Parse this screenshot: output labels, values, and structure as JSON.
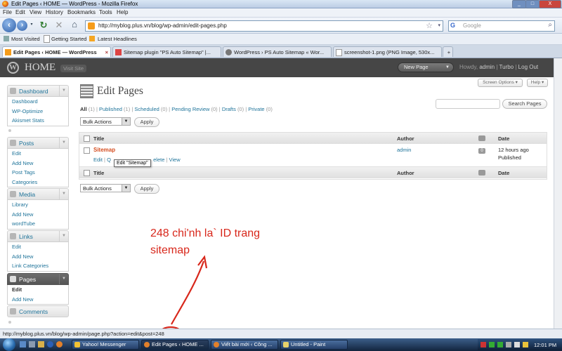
{
  "window": {
    "title": "Edit Pages ‹ HOME — WordPress - Mozilla Firefox",
    "min": "_",
    "max": "□",
    "close": "X"
  },
  "menu": [
    "File",
    "Edit",
    "View",
    "History",
    "Bookmarks",
    "Tools",
    "Help"
  ],
  "nav": {
    "url": "http://myblog.plus.vn/blog/wp-admin/edit-pages.php",
    "search_placeholder": "Google"
  },
  "bookmarks": [
    "Most Visited",
    "Getting Started",
    "Latest Headlines"
  ],
  "tabs": [
    {
      "label": "Edit Pages ‹ HOME — WordPress",
      "active": true
    },
    {
      "label": "Sitemap plugin \"PS Auto Sitemap\" |..."
    },
    {
      "label": "WordPress › PS Auto Sitemap « Wor..."
    },
    {
      "label": "screenshot-1.png (PNG Image, 530x..."
    }
  ],
  "wp_header": {
    "site_name": "HOME",
    "visit_site": "Visit Site",
    "new_page": "New Page",
    "howdy": "Howdy,",
    "username": "admin",
    "sep1": "|",
    "turbo": "Turbo",
    "sep2": "|",
    "logout": "Log Out"
  },
  "sidebar": {
    "dashboard": {
      "label": "Dashboard",
      "items": [
        "Dashboard",
        "WP-Optimize",
        "Akismet Stats"
      ]
    },
    "posts": {
      "label": "Posts",
      "items": [
        "Edit",
        "Add New",
        "Post Tags",
        "Categories"
      ]
    },
    "media": {
      "label": "Media",
      "items": [
        "Library",
        "Add New",
        "wordTube"
      ]
    },
    "links": {
      "label": "Links",
      "items": [
        "Edit",
        "Add New",
        "Link Categories"
      ]
    },
    "pages": {
      "label": "Pages",
      "items": [
        "Edit",
        "Add New"
      ]
    },
    "comments": {
      "label": "Comments"
    }
  },
  "main": {
    "screen_options": "Screen Options ▾",
    "help": "Help ▾",
    "title": "Edit Pages",
    "filters": {
      "all": "All",
      "all_count": "(1)",
      "published": "Published",
      "published_count": "(1)",
      "scheduled": "Scheduled",
      "scheduled_count": "(0)",
      "pending": "Pending Review",
      "pending_count": "(0)",
      "drafts": "Drafts",
      "drafts_count": "(0)",
      "private": "Private",
      "private_count": "(0)",
      "sep": "|"
    },
    "search_button": "Search Pages",
    "bulk_actions": "Bulk Actions",
    "apply": "Apply",
    "columns": {
      "title": "Title",
      "author": "Author",
      "date": "Date"
    },
    "row": {
      "title": "Sitemap",
      "edit": "Edit",
      "quick_edit": "Q",
      "delete": "elete",
      "view": "View",
      "sep": "|",
      "author": "admin",
      "comments": "0",
      "date": "12 hours ago",
      "status": "Published"
    },
    "tooltip": "Edit \"Sitemap\""
  },
  "annotation": {
    "line1": "248 chi'nh la` ID trang",
    "line2": "sitemap"
  },
  "status": {
    "url_prefix": "http://myblog.plus.vn/blog/wp-admin/page.php?action=edit&post=",
    "post_id": "248"
  },
  "taskbar": {
    "items": [
      "Yahoo! Messenger",
      "Edit Pages ‹ HOME ...",
      "Viết bài mới ‹ Công ...",
      "Untitled - Paint"
    ],
    "clock": "12:01 PM"
  }
}
